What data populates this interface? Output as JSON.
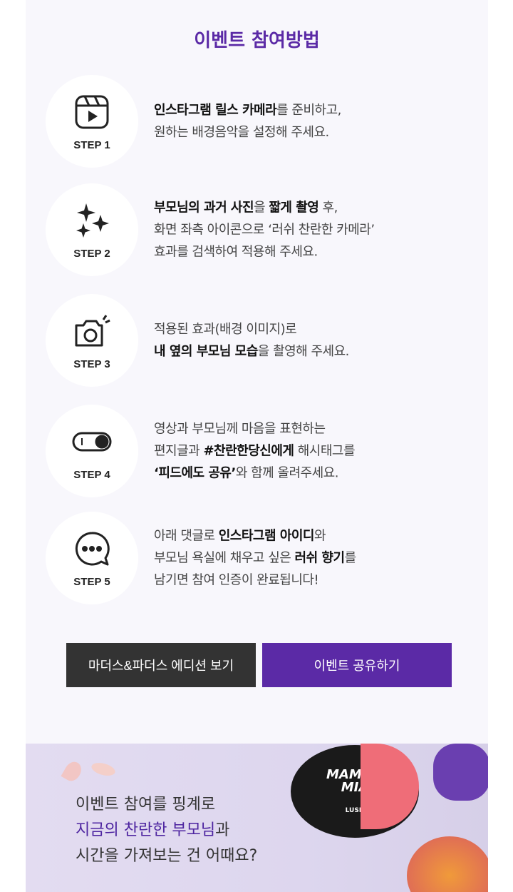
{
  "title": "이벤트 참여방법",
  "steps": [
    {
      "label": "STEP 1",
      "icon": "reels-icon",
      "lines": [
        [
          {
            "t": "인스타그램 릴스 카메라",
            "b": true
          },
          {
            "t": "를 준비하고,",
            "b": false
          }
        ],
        [
          {
            "t": "원하는 배경음악을 설정해 주세요.",
            "b": false
          }
        ]
      ]
    },
    {
      "label": "STEP 2",
      "icon": "sparkles-icon",
      "lines": [
        [
          {
            "t": "부모님의 과거 사진",
            "b": true
          },
          {
            "t": "을 ",
            "b": false
          },
          {
            "t": "짧게 촬영",
            "b": true
          },
          {
            "t": " 후,",
            "b": false
          }
        ],
        [
          {
            "t": "화면 좌측 아이콘으로 ‘러쉬 찬란한 카메라’",
            "b": false
          }
        ],
        [
          {
            "t": "효과를 검색하여 적용해 주세요.",
            "b": false
          }
        ]
      ]
    },
    {
      "label": "STEP 3",
      "icon": "camera-icon",
      "lines": [
        [
          {
            "t": "적용된 효과(배경 이미지)로",
            "b": false
          }
        ],
        [
          {
            "t": "내 옆의 부모님 모습",
            "b": true
          },
          {
            "t": "을 촬영해 주세요.",
            "b": false
          }
        ]
      ]
    },
    {
      "label": "STEP 4",
      "icon": "toggle-icon",
      "lines": [
        [
          {
            "t": "영상과 부모님께 마음을 표현하는",
            "b": false
          }
        ],
        [
          {
            "t": "편지글과 ",
            "b": false
          },
          {
            "t": "#찬란한당신에게",
            "b": true
          },
          {
            "t": " 해시태그를",
            "b": false
          }
        ],
        [
          {
            "t": "‘피드에도 공유’",
            "b": true
          },
          {
            "t": "와 함께 올려주세요.",
            "b": false
          }
        ]
      ]
    },
    {
      "label": "STEP 5",
      "icon": "chat-bubble-icon",
      "lines": [
        [
          {
            "t": "아래 댓글로 ",
            "b": false
          },
          {
            "t": "인스타그램 아이디",
            "b": true
          },
          {
            "t": "와",
            "b": false
          }
        ],
        [
          {
            "t": "부모님 욕실에 채우고 싶은 ",
            "b": false
          },
          {
            "t": "러쉬 향기",
            "b": true
          },
          {
            "t": "를",
            "b": false
          }
        ],
        [
          {
            "t": "남기면 참여 인증이 완료됩니다!",
            "b": false
          }
        ]
      ]
    }
  ],
  "buttons": {
    "edition": "마더스&파더스 에디션 보기",
    "share": "이벤트 공유하기"
  },
  "banner": {
    "line1": "이벤트 참여를 핑계로",
    "line2_highlight": "지금의 찬란한 부모님",
    "line2_rest": "과",
    "line3": "시간을 가져보는 건 어때요?",
    "product_brand": "LUSH",
    "product_name": "MAMMA MIA"
  },
  "colors": {
    "accent": "#5b2aa6",
    "dark_button": "#333333",
    "panel_bg": "#f8f7fc"
  }
}
